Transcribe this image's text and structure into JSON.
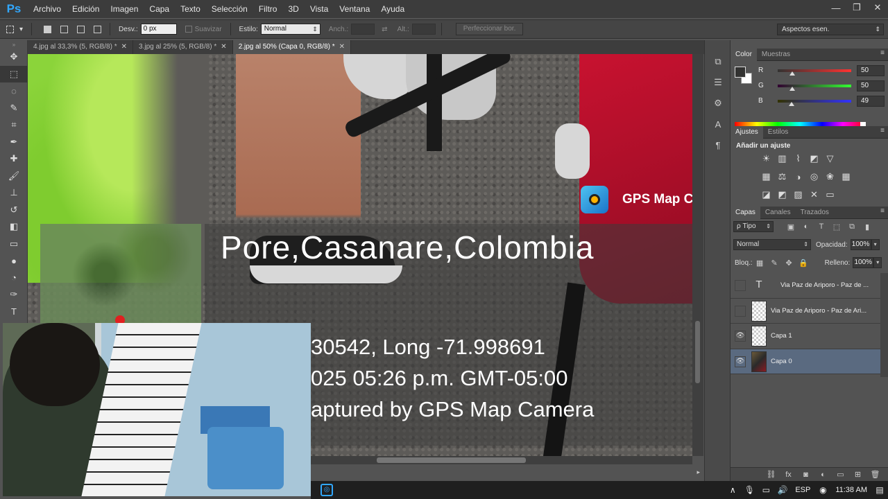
{
  "app": {
    "logo": "Ps"
  },
  "menu": [
    "Archivo",
    "Edición",
    "Imagen",
    "Capa",
    "Texto",
    "Selección",
    "Filtro",
    "3D",
    "Vista",
    "Ventana",
    "Ayuda"
  ],
  "window_controls": {
    "minimize": "—",
    "restore": "❐",
    "close": "✕"
  },
  "options": {
    "feather_label": "Desv.:",
    "feather_value": "0 px",
    "antialias_label": "Suavizar",
    "style_label": "Estilo:",
    "style_value": "Normal",
    "width_label": "Anch.:",
    "height_label": "Alt.:",
    "refine_button": "Perfeccionar bor.",
    "workspace": "Aspectos esen."
  },
  "tabs": [
    {
      "label": "4.jpg al 33,3% (5, RGB/8) *",
      "close": "✕"
    },
    {
      "label": "3.jpg al 25% (5, RGB/8) *",
      "close": "✕"
    },
    {
      "label": "2.jpg al 50% (Capa 0, RGB/8) *",
      "close": "✕"
    }
  ],
  "canvas": {
    "gps_brand": "GPS Map C",
    "location": "Pore,Casanare,Colombia",
    "coords": "30542, Long -71.998691",
    "datetime": "025 05:26 p.m. GMT-05:00",
    "captured": "aptured by GPS Map Camera"
  },
  "color_panel": {
    "tabs": [
      "Color",
      "Muestras"
    ],
    "menu": "≡",
    "r_label": "R",
    "r_value": "50",
    "g_label": "G",
    "g_value": "50",
    "b_label": "B",
    "b_value": "49",
    "r_level": 0.196,
    "g_level": 0.196,
    "b_level": 0.192,
    "foreground": "#323231",
    "background": "#ffffff"
  },
  "adjust_panel": {
    "tabs": [
      "Ajustes",
      "Estilos"
    ],
    "menu": "≡",
    "title": "Añadir un ajuste"
  },
  "layers_panel": {
    "tabs": [
      "Capas",
      "Canales",
      "Trazados"
    ],
    "menu": "≡",
    "kind_filter": "ρ Tipo",
    "blend_mode": "Normal",
    "opacity_label": "Opacidad:",
    "opacity_value": "100%",
    "lock_label": "Bloq.:",
    "fill_label": "Relleno:",
    "fill_value": "100%",
    "layers": [
      {
        "name": "Via Paz de Ariporo - Paz de ...",
        "type": "text",
        "visible": false
      },
      {
        "name": "Via Paz de Ariporo - Paz de Ari...",
        "type": "raster",
        "visible": false
      },
      {
        "name": "Capa 1",
        "type": "raster",
        "visible": true
      },
      {
        "name": "Capa 0",
        "type": "photo",
        "visible": true,
        "selected": true
      }
    ]
  },
  "taskbar": {
    "language": "ESP",
    "time": "11:38 AM"
  }
}
